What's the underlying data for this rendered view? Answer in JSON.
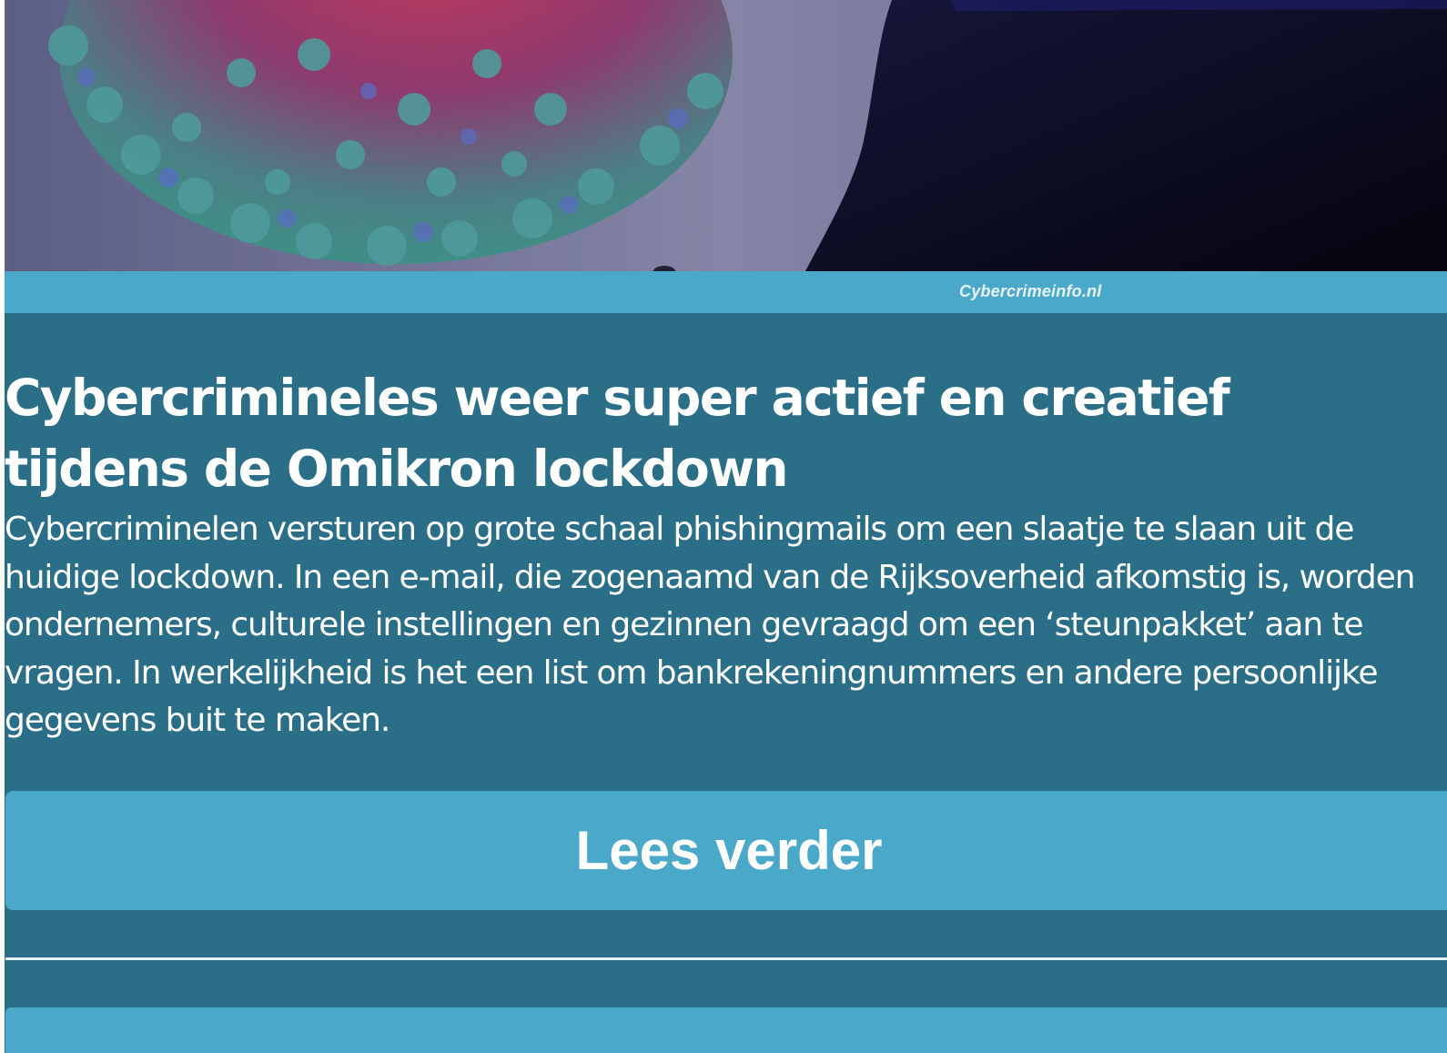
{
  "hero": {
    "image_subject": "coronavirus-illustration",
    "caption": "Cybercrimeinfo.nl"
  },
  "article": {
    "title": "Cybercrimineles weer super actief en creatief tijdens de Omikron lockdown",
    "summary": "Cybercriminelen versturen op grote schaal phishingmails om een slaatje te slaan uit de huidige lockdown. In een e-mail, die zogenaamd van de Rijksoverheid afkomstig is, worden ondernemers, culturele instellingen en gezinnen gevraagd om een ‘steunpakket’ aan te vragen. In werkelijkheid is het een list om bankrekeningnummers en andere persoonlijke gegevens buit te maken.",
    "read_more_label": "Lees verder"
  },
  "colors": {
    "panel_background": "#2a6e87",
    "accent": "#4aa8c9",
    "text": "#ffffff"
  }
}
